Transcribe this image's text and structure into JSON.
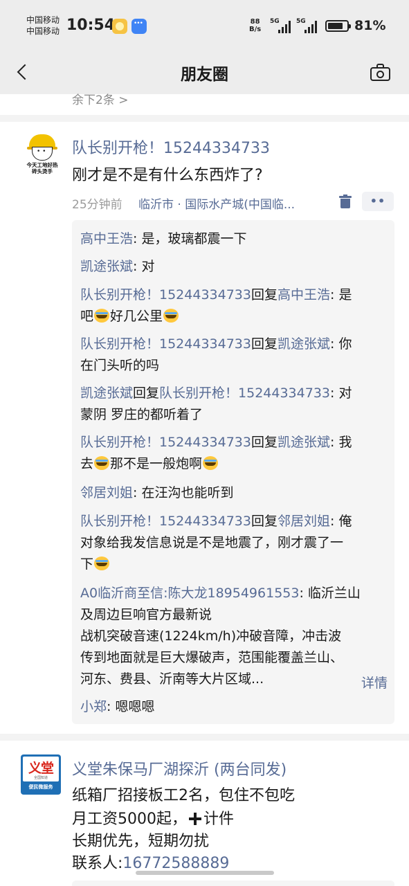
{
  "status_bar": {
    "carrier_1": "中国移动",
    "carrier_2": "中国移动",
    "time": "10:54",
    "net_speed_value": "88",
    "net_speed_unit": "B/s",
    "signal_1": "5G",
    "signal_2": "5G",
    "battery_percent": "81%",
    "battery_level": 0.81
  },
  "nav": {
    "title": "朋友圈",
    "back_icon": "chevron-left-icon",
    "camera_icon": "camera-icon"
  },
  "partial_prev_text": "余下2条 >",
  "post1": {
    "avatar_caption_1": "今天工地好热",
    "avatar_caption_2": "砖头烫手",
    "author": "队长别开枪！15244334733",
    "text": "刚才是不是有什么东西炸了?",
    "time": "25分钟前",
    "location": "临沂市 · 国际水产城(中国临...",
    "more_label": "••",
    "comments": [
      {
        "name": "高中王浩",
        "sep": ": ",
        "text": "是，玻璃都震一下"
      },
      {
        "name": "凯途张斌",
        "sep": ": ",
        "text": "对"
      },
      {
        "name": "队长别开枪！15244334733",
        "reply_word": "回复",
        "reply_to": "高中王浩",
        "sep": ": ",
        "text_1": "是",
        "text_2": "吧",
        "text_3": "好几公里"
      },
      {
        "name": "队长别开枪！15244334733",
        "reply_word": "回复",
        "reply_to": "凯途张斌",
        "sep": ": ",
        "text_1": "你",
        "text_2": "在门头听的吗"
      },
      {
        "name": "凯途张斌",
        "reply_word": "回复",
        "reply_to": "队长别开枪！15244334733",
        "sep": ": ",
        "text_1": "对",
        "text_2": "蒙阴  罗庄的都听着了"
      },
      {
        "name": "队长别开枪！15244334733",
        "reply_word": "回复",
        "reply_to": "凯途张斌",
        "sep": ": ",
        "text_1": "我",
        "text_2": "去",
        "text_3": "那不是一般炮啊"
      },
      {
        "name": "邻居刘姐",
        "sep": ": ",
        "text": "在汪沟也能听到"
      },
      {
        "name": "队长别开枪！15244334733",
        "reply_word": "回复",
        "reply_to": "邻居刘姐",
        "sep": ": ",
        "text_1": "俺",
        "text_2": "对象给我发信息说是不是地震了，刚才震了一",
        "text_3": "下"
      },
      {
        "name": "A0临沂商至信:陈大龙18954961553",
        "sep": ": ",
        "text_1": "临沂兰山",
        "text_2": "及周边巨响官方最新说",
        "text_3": "战机突破音速(1224km/h)冲破音障，冲击波",
        "text_4": "传到地面就是巨大爆破声，范围能覆盖兰山、",
        "text_5": "河东、费县、沂南等大片区域..."
      },
      {
        "name": "小郑",
        "sep": ": ",
        "text": "嗯嗯嗯"
      }
    ],
    "detail_link": "详情"
  },
  "post2": {
    "avatar_brand": "义堂",
    "avatar_sub": "全国知道",
    "avatar_foot": "便民微服务",
    "author": "义堂朱保马厂湖探沂 (两台同发)",
    "line_1": "纸箱厂招接板工2名，包住不包吃",
    "line_2a": "月工资5000起，",
    "line_2b": "计件",
    "line_3": "长期优先，短期勿扰",
    "line_4a": "联系人:",
    "line_4b": "16772588889"
  }
}
